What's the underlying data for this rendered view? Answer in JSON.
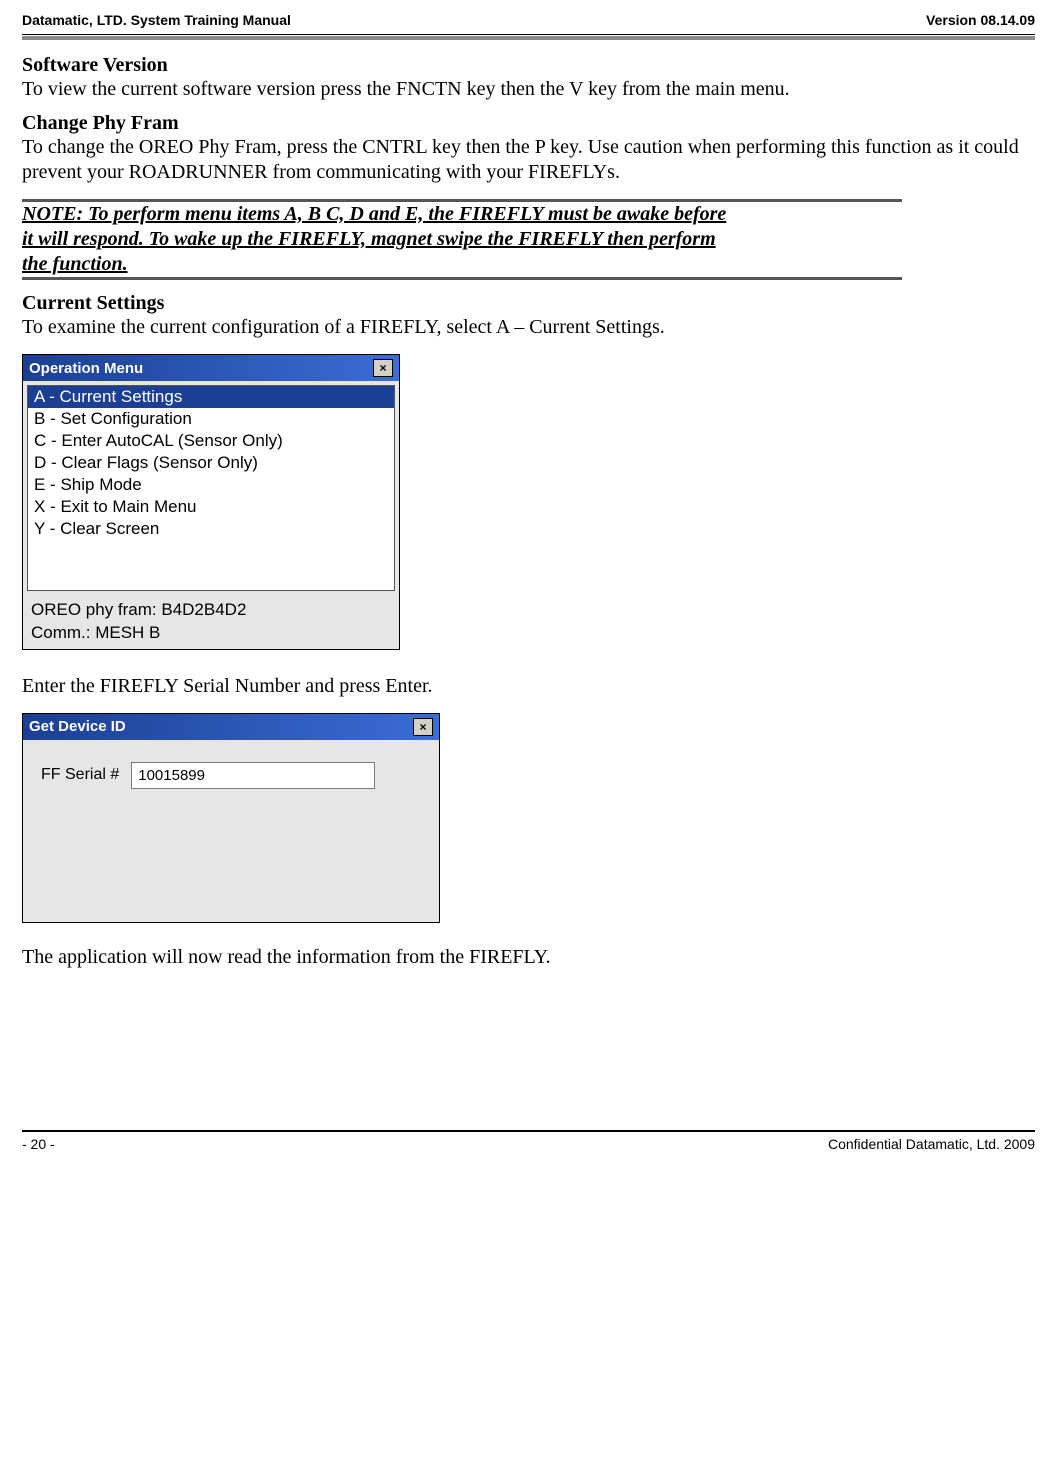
{
  "header": {
    "left": "Datamatic, LTD. System Training  Manual",
    "right": "Version 08.14.09"
  },
  "section1": {
    "heading": "Software Version",
    "text": "To view the current software version press the FNCTN key then the V key from the main menu."
  },
  "section2": {
    "heading": "Change Phy Fram",
    "text": "To change the OREO Phy Fram, press the CNTRL key then the P key.  Use caution when performing this function as it could prevent your ROADRUNNER from communicating with your FIREFLYs."
  },
  "note": {
    "line1": "NOTE: To perform menu items A, B C, D and E, the FIREFLY must be awake before",
    "line2": "it will respond.  To wake up the FIREFLY, magnet swipe the FIREFLY then perform",
    "line3": "the function."
  },
  "section3": {
    "heading": "Current Settings",
    "text": "To examine the current configuration of a FIREFLY, select A – Current Settings."
  },
  "operationMenu": {
    "title": "Operation Menu",
    "items": {
      "a": "A - Current Settings",
      "b": "B - Set Configuration",
      "c": "C - Enter AutoCAL (Sensor Only)",
      "d": "D - Clear Flags (Sensor Only)",
      "e": "E - Ship Mode",
      "x": "X - Exit to Main Menu",
      "y": "Y - Clear Screen"
    },
    "statusLine1": "OREO phy fram: B4D2B4D2",
    "statusLine2": "Comm.: MESH   B"
  },
  "midText": "Enter the FIREFLY Serial Number and press Enter.",
  "deviceDialog": {
    "title": "Get Device ID",
    "label": "FF Serial #",
    "value": "10015899"
  },
  "afterText": "The application will now read the information from the FIREFLY.",
  "footer": {
    "left": "- 20 -",
    "right": "Confidential Datamatic, Ltd. 2009"
  },
  "ui": {
    "closeX": "×"
  }
}
